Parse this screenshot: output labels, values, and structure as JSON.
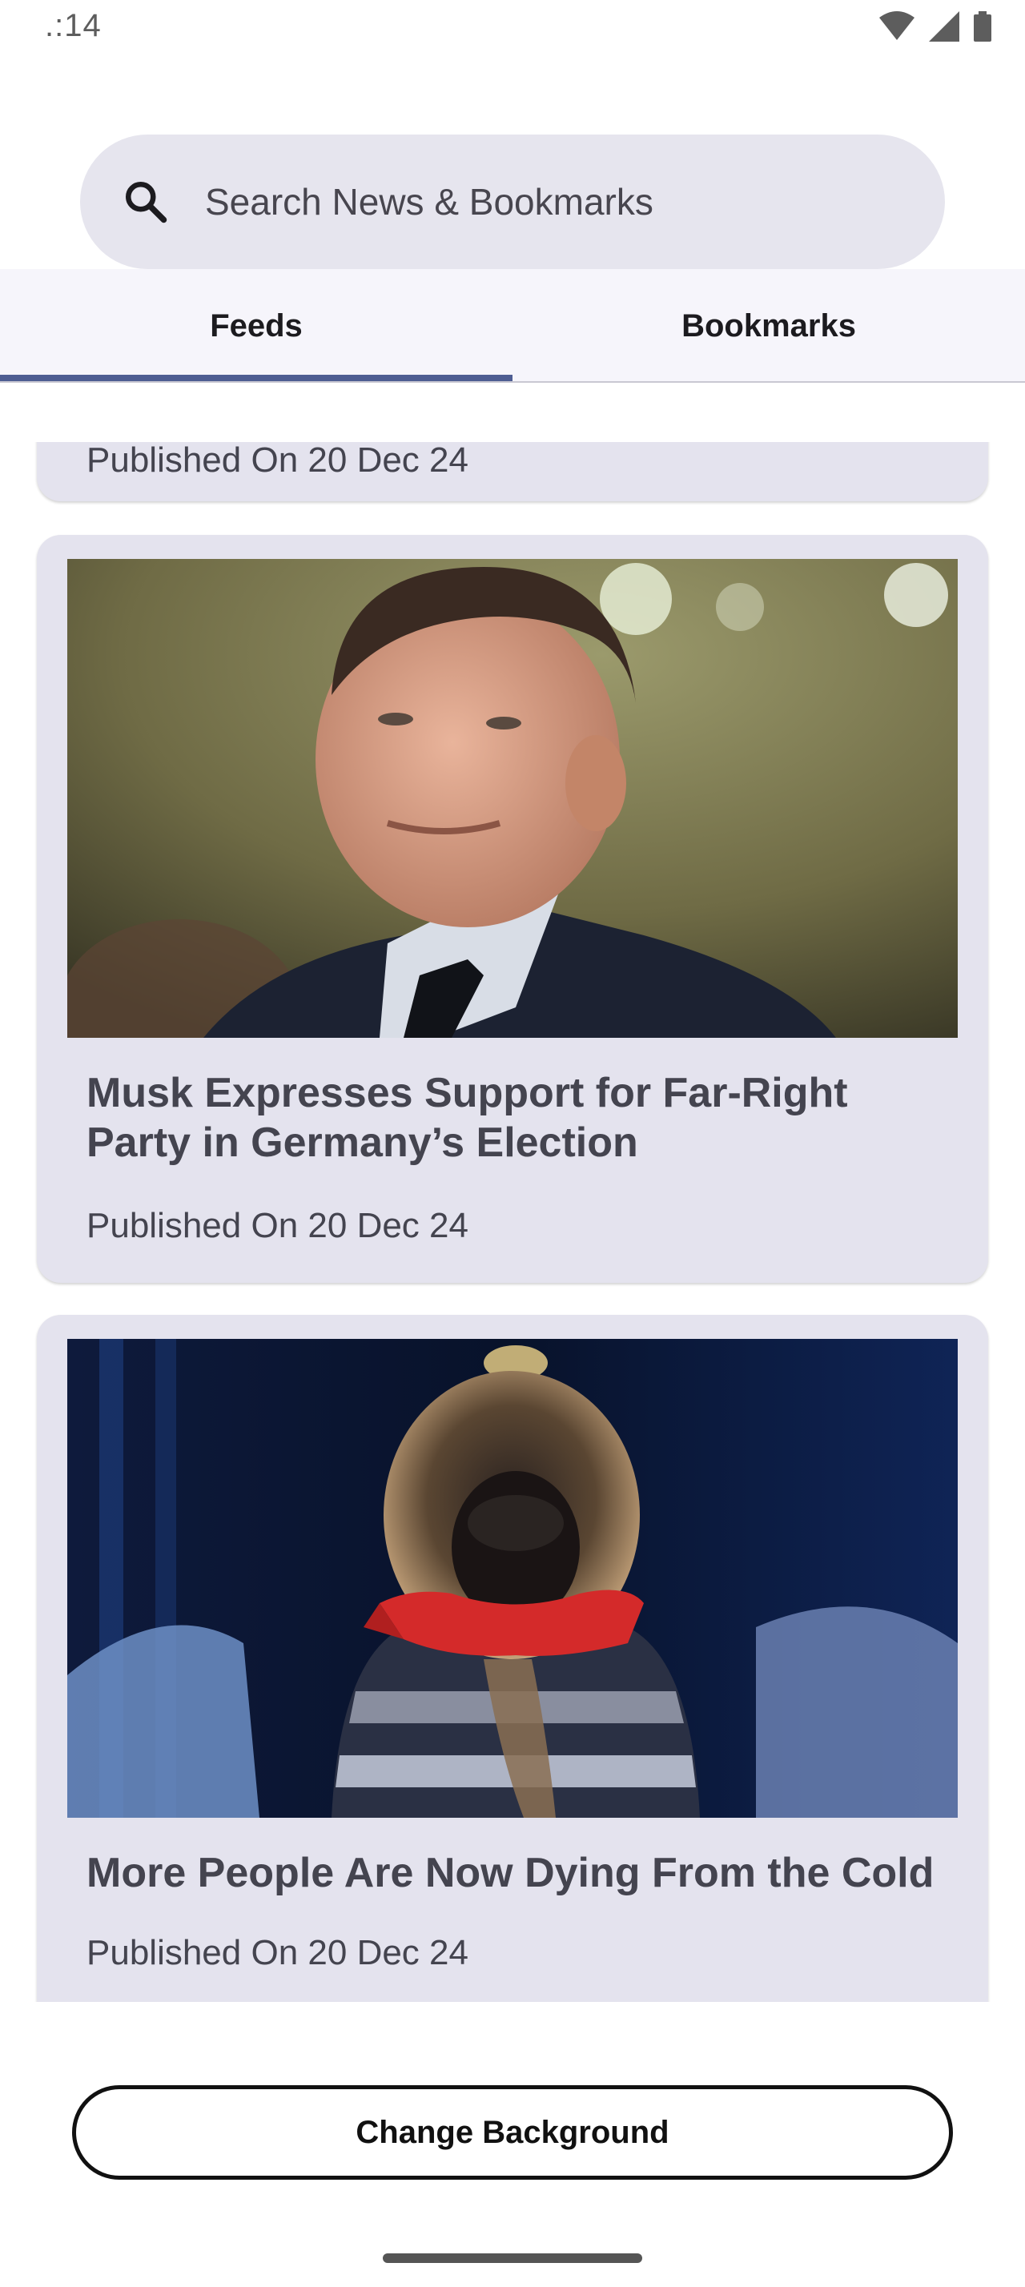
{
  "status_bar": {
    "time": ".:14",
    "icons": [
      "wifi-icon",
      "signal-icon",
      "battery-icon"
    ]
  },
  "search": {
    "placeholder": "Search News & Bookmarks",
    "icon": "search-icon"
  },
  "tabs": [
    {
      "label": "Feeds",
      "selected": true
    },
    {
      "label": "Bookmarks",
      "selected": false
    }
  ],
  "feed": {
    "partial_card": {
      "date": "Published On 20 Dec 24"
    },
    "articles": [
      {
        "title": "Musk Expresses Support for Far-Right Party in Germany’s Election",
        "date": "Published On 20 Dec 24",
        "image": "portrait photo of a man in a dark suit"
      },
      {
        "title": "More People Are Now Dying From the Cold",
        "date": "Published On 20 Dec 24",
        "image": "person in fur-hooded winter coat and red scarf"
      }
    ]
  },
  "footer": {
    "button_label": "Change Background"
  },
  "colors": {
    "accent": "#4e5d92",
    "card_bg": "#e4e3ee",
    "search_bg": "#e6e5ee",
    "tab_bg": "#f6f5fb"
  }
}
